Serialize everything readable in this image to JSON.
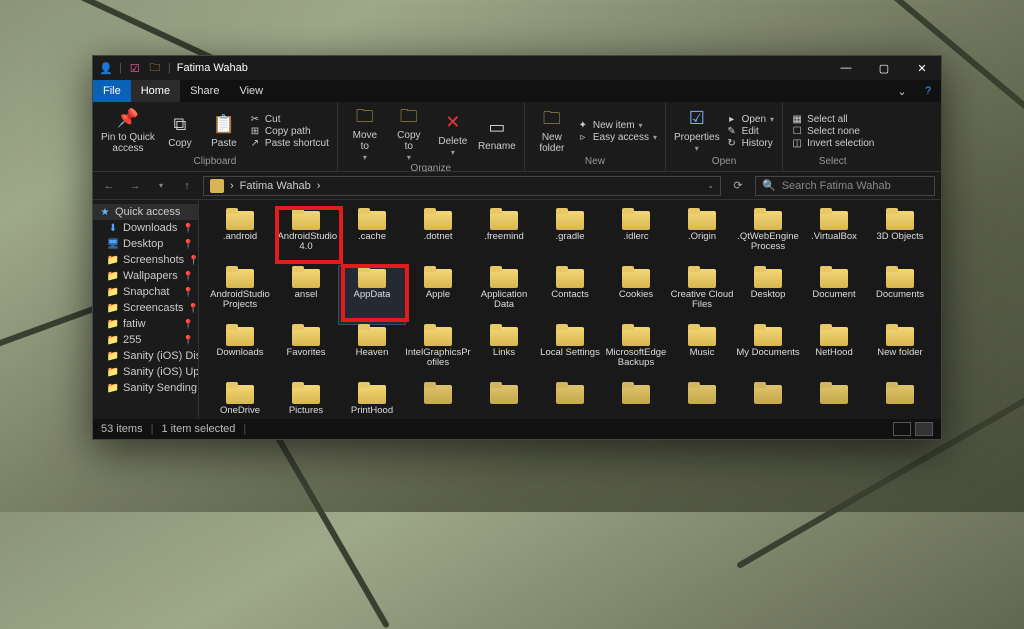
{
  "window": {
    "title": "Fatima Wahab",
    "search_placeholder": "Search Fatima Wahab"
  },
  "win_controls": {
    "min": "—",
    "max": "▢",
    "close": "✕",
    "help": "?",
    "caret": "⌄"
  },
  "menubar": {
    "file": "File",
    "home": "Home",
    "share": "Share",
    "view": "View"
  },
  "ribbon": {
    "clipboard": {
      "label": "Clipboard",
      "pin": "Pin to Quick\naccess",
      "copy": "Copy",
      "paste": "Paste",
      "cut": "Cut",
      "copy_path": "Copy path",
      "paste_shortcut": "Paste shortcut"
    },
    "organize": {
      "label": "Organize",
      "move_to": "Move\nto",
      "copy_to": "Copy\nto",
      "delete": "Delete",
      "rename": "Rename"
    },
    "new": {
      "label": "New",
      "new_folder": "New\nfolder",
      "new_item": "New item",
      "easy_access": "Easy access"
    },
    "open": {
      "label": "Open",
      "properties": "Properties",
      "open": "Open",
      "edit": "Edit",
      "history": "History"
    },
    "select": {
      "label": "Select",
      "select_all": "Select all",
      "select_none": "Select none",
      "invert": "Invert selection"
    }
  },
  "breadcrumb": {
    "user": "Fatima Wahab",
    "sep": "›"
  },
  "sidebar": {
    "quick_access": "Quick access",
    "items": [
      {
        "label": "Downloads",
        "icon": "⬇",
        "color": "#4aa3ff"
      },
      {
        "label": "Desktop",
        "icon": "🖥",
        "color": "#4aa3ff"
      },
      {
        "label": "Screenshots",
        "icon": "📁",
        "color": "#d7b454"
      },
      {
        "label": "Wallpapers",
        "icon": "📁",
        "color": "#d7b454"
      },
      {
        "label": "Snapchat",
        "icon": "📁",
        "color": "#d7b454"
      },
      {
        "label": "Screencasts",
        "icon": "📁",
        "color": "#d7b454"
      },
      {
        "label": "fatiw",
        "icon": "📁",
        "color": "#d7b454"
      },
      {
        "label": "255",
        "icon": "📁",
        "color": "#d7b454"
      },
      {
        "label": "Sanity (iOS) Disc",
        "icon": "📁",
        "color": "#d7b454"
      },
      {
        "label": "Sanity (iOS) Upd",
        "icon": "📁",
        "color": "#d7b454"
      },
      {
        "label": "Sanity Sending a",
        "icon": "📁",
        "color": "#d7b454"
      }
    ]
  },
  "folders": [
    ".android",
    ".AndroidStudio4.0",
    ".cache",
    ".dotnet",
    ".freemind",
    ".gradle",
    ".idlerc",
    ".Origin",
    ".QtWebEngineProcess",
    ".VirtualBox",
    "3D Objects",
    "AndroidStudioProjects",
    "ansel",
    "AppData",
    "Apple",
    "Application Data",
    "Contacts",
    "Cookies",
    "Creative Cloud Files",
    "Desktop",
    "Document",
    "Documents",
    "Downloads",
    "Favorites",
    "Heaven",
    "IntelGraphicsProfiles",
    "Links",
    "Local Settings",
    "MicrosoftEdgeBackups",
    "Music",
    "My Documents",
    "NetHood",
    "New folder",
    "OneDrive",
    "Pictures",
    "PrintHood"
  ],
  "highlighted": [
    1,
    13
  ],
  "selected_index": 13,
  "status": {
    "items": "53 items",
    "selected": "1 item selected"
  }
}
